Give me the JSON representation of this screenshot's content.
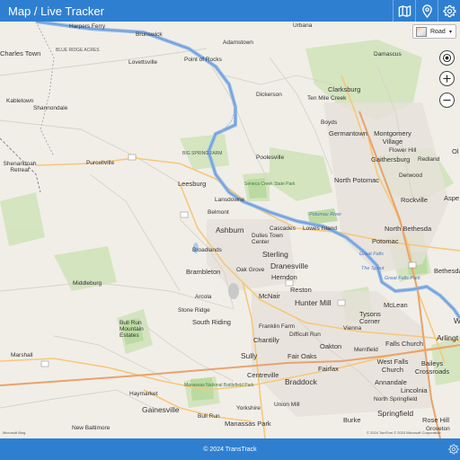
{
  "header": {
    "title": "Map / Live Tracker",
    "icons": [
      "map-icon",
      "location-pin-icon",
      "settings-gear-icon"
    ]
  },
  "map_type": {
    "selected": "Road"
  },
  "controls": [
    "locate-icon",
    "zoom-in-icon",
    "zoom-out-icon"
  ],
  "attribution_left": "Microsoft Bing",
  "attribution_right": "© 2024 TomTom © 2024 Microsoft Corporation",
  "footer": {
    "text": "© 2024 TransTrack"
  },
  "places": {
    "harpers_ferry": "Harpers Ferry",
    "brunswick": "Brunswick",
    "adamstown": "Adamstown",
    "urbana": "Urbana",
    "damascus": "Damascus",
    "charles_town": "Charles Town",
    "blue_ridge_acres": "BLUE RIDGE ACRES",
    "lovettsville": "Lovettsville",
    "point_of_rocks": "Point of Rocks",
    "clarksburg": "Clarksburg",
    "ten_mile_creek": "Ten Mile Creek",
    "kabletown": "Kabletown",
    "shannondale": "Shannondale",
    "dickerson": "Dickerson",
    "boyds": "Boyds",
    "germantown": "Germantown",
    "montgomery_village": "Montgomery Village",
    "big_spring_farm": "BIG SPRING FARM",
    "poolesville": "Poolesville",
    "flower_hill": "Flower Hill",
    "gaithersburg": "Gaithersburg",
    "redland": "Redland",
    "olney": "Ol",
    "shenandoah_retreat": "Shenandoah Retreat",
    "purcellville": "Purcellville",
    "leesburg": "Leesburg",
    "north_potomac": "North Potomac",
    "derwood": "Derwood",
    "lansdowne": "Lansdowne",
    "belmont": "Belmont",
    "rockville": "Rockville",
    "aspen": "Aspe",
    "ashburn": "Ashburn",
    "dulles_town_center": "Dulles Town Center",
    "cascades": "Cascades",
    "lowes_island": "Lowes Island",
    "north_bethesda": "North Bethesda",
    "sterling": "Sterling",
    "potomac": "Potomac",
    "broadlands": "Broadlands",
    "dranesville": "Dranesville",
    "great_falls": "Great Falls",
    "bethesda": "Bethesda",
    "brambleton": "Brambleton",
    "oak_grove": "Oak Grove",
    "herndon": "Herndon",
    "the_spout": "The Spout",
    "middleburg": "Middleburg",
    "reston": "Reston",
    "arcola": "Arcola",
    "mcnair": "McNair",
    "hunter_mill": "Hunter Mill",
    "mclean": "McLean",
    "stone_ridge": "Stone Ridge",
    "tysons_corner": "Tysons Corner",
    "south_riding": "South Riding",
    "bull_run_mountain_estates": "Bull Run Mountain Estates",
    "franklin_farm": "Franklin Farm",
    "vienna": "Vienna",
    "difficult_run": "Difficult Run",
    "chantilly": "Chantilly",
    "falls_church": "Falls Church",
    "arlington": "Arlingt",
    "oakton": "Oakton",
    "merrifield": "Merrifield",
    "marshall": "Marshall",
    "sully": "Sully",
    "fair_oaks": "Fair Oaks",
    "west_falls_church": "West Falls Church",
    "baileys_crossroads": "Baileys Crossroads",
    "fairfax": "Fairfax",
    "centreville": "Centreville",
    "braddock": "Braddock",
    "annandale": "Annandale",
    "haymarket": "Haymarket",
    "manassas_battlefield": "Manassas National Battlefield Park",
    "lincolnia": "Lincolnia",
    "north_springfield": "North Springfield",
    "gainesville": "Gainesville",
    "yorkshire": "Yorkshire",
    "union_mill": "Union Mill",
    "springfield": "Springfield",
    "bull_run": "Bull Run",
    "manassas_park": "Manassas Park",
    "new_baltimore": "New Baltimore",
    "burke": "Burke",
    "rose_hill": "Rose Hill",
    "groveton": "Groveton",
    "sudley": "Sudley",
    "potomac_river": "Potomac River",
    "seneca_creek": "Seneca Creek State Park",
    "great_falls_park": "Great Falls Park",
    "w": "W"
  }
}
